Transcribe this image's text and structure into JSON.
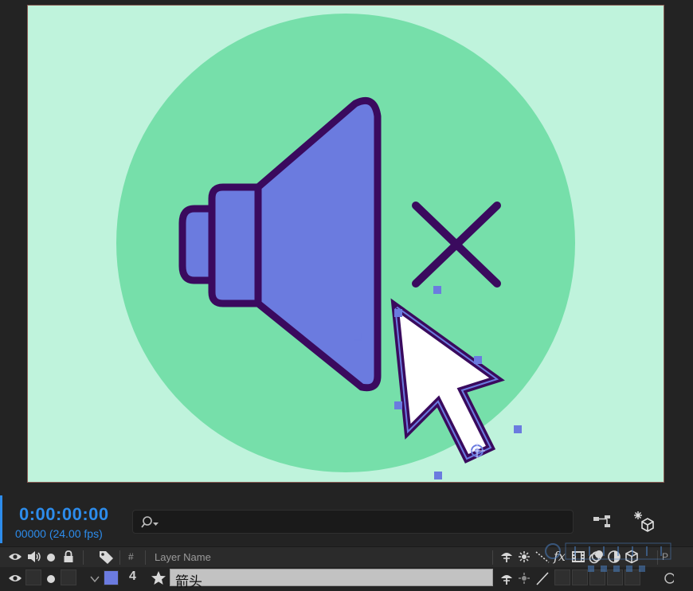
{
  "composition": {
    "background_color": "#bff3dc",
    "circle_color": "#76dfaa",
    "speaker_fill": "#6b7bdf",
    "outline_color": "#3a0a5e",
    "mute_x_color": "#3a0a5e",
    "cursor_fill": "#ffffff",
    "handle_color": "#6b7bdf"
  },
  "timeline": {
    "timecode": "0:00:00:00",
    "frame_readout": "00000 (24.00 fps)",
    "search_placeholder": "",
    "accent_color": "#2d8ceb",
    "columns": {
      "hash": "#",
      "layer_name": "Layer Name",
      "parent_partial": "P"
    },
    "layers": [
      {
        "number": "4",
        "name": "箭头",
        "label_color": "#6b7bdf",
        "expanded": false
      }
    ]
  },
  "icons": {
    "search": "search-icon",
    "flowchart": "flowchart-icon",
    "draft3d": "draft-3d-icon",
    "eye": "eye-icon",
    "audio": "audio-icon",
    "solo": "solo-icon",
    "lock": "lock-icon",
    "label": "tag-icon",
    "shy": "shy-icon",
    "collapse": "collapse-icon",
    "quality": "quality-icon",
    "fx": "fx-icon",
    "frame_blend": "frame-blend-icon",
    "motion_blur": "motion-blur-icon",
    "adjustment": "adjustment-icon",
    "3d_layer": "3d-layer-icon",
    "star": "star-icon"
  }
}
